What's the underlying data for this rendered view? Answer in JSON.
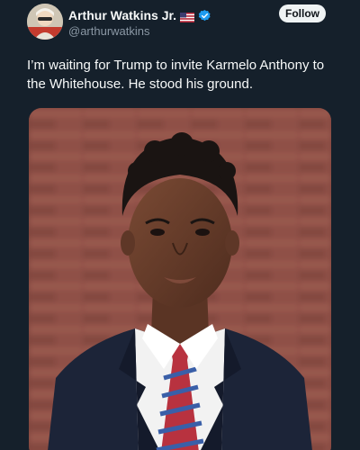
{
  "user": {
    "display_name": "Arthur Watkins Jr.",
    "flag": "us-flag",
    "verified": "verified-badge-icon",
    "handle": "@arthurwatkins"
  },
  "follow_label": "Follow",
  "tweet": {
    "text": "I’m waiting for Trump to invite Karmelo Anthony to the Whitehouse. He stood his ground."
  },
  "colors": {
    "background": "#15202b",
    "verified_blue": "#1d9bf0",
    "follow_bg": "#eff3f4"
  }
}
